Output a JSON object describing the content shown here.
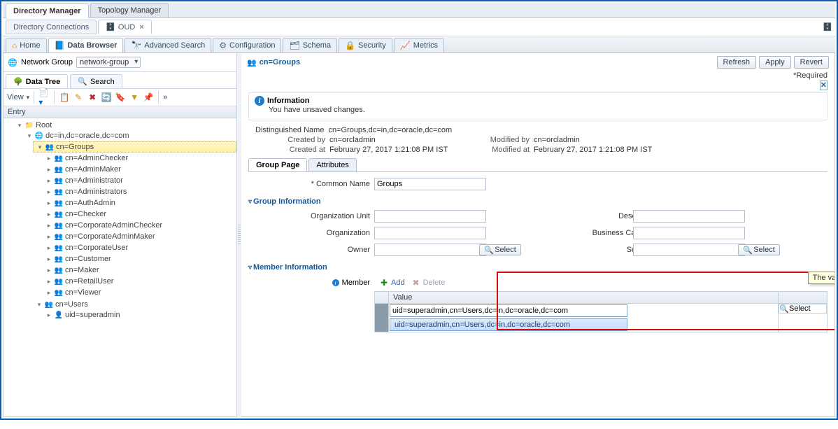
{
  "top_tabs": {
    "directory_manager": "Directory Manager",
    "topology_manager": "Topology Manager"
  },
  "conn_tabs": {
    "directory_connections": "Directory Connections",
    "oud": "OUD"
  },
  "main_tabs": {
    "home": "Home",
    "data_browser": "Data Browser",
    "advanced_search": "Advanced Search",
    "configuration": "Configuration",
    "schema": "Schema",
    "security": "Security",
    "metrics": "Metrics"
  },
  "network_group": {
    "label": "Network Group",
    "value": "network-group"
  },
  "tree_tabs": {
    "data_tree": "Data Tree",
    "search": "Search"
  },
  "toolbar": {
    "view": "View",
    "more": "»"
  },
  "tree": {
    "entry_header": "Entry",
    "root": "Root",
    "dc": "dc=in,dc=oracle,dc=com",
    "groups": "cn=Groups",
    "group_children": [
      "cn=AdminChecker",
      "cn=AdminMaker",
      "cn=Administrator",
      "cn=Administrators",
      "cn=AuthAdmin",
      "cn=Checker",
      "cn=CorporateAdminChecker",
      "cn=CorporateAdminMaker",
      "cn=CorporateUser",
      "cn=Customer",
      "cn=Maker",
      "cn=RetailUser",
      "cn=Viewer"
    ],
    "users": "cn=Users",
    "user_children": [
      "uid=superadmin"
    ]
  },
  "right": {
    "title": "cn=Groups",
    "buttons": {
      "refresh": "Refresh",
      "apply": "Apply",
      "revert": "Revert"
    },
    "required": "*Required",
    "info": {
      "title": "Information",
      "msg": "You have unsaved changes."
    },
    "dn_label": "Distinguished Name",
    "dn_value": "cn=Groups,dc=in,dc=oracle,dc=com",
    "created_by_l": "Created by",
    "created_by_v": "cn=orcladmin",
    "created_at_l": "Created at",
    "created_at_v": "February 27, 2017 1:21:08 PM IST",
    "modified_by_l": "Modified by",
    "modified_by_v": "cn=orcladmin",
    "modified_at_l": "Modified at",
    "modified_at_v": "February 27, 2017 1:21:08 PM IST",
    "sub_tabs": {
      "group_page": "Group Page",
      "attributes": "Attributes"
    },
    "common_name_l": "* Common Name",
    "common_name_v": "Groups",
    "sections": {
      "group_info": "Group Information",
      "member_info": "Member Information"
    },
    "fields": {
      "org_unit": "Organization Unit",
      "description": "Description",
      "organization": "Organization",
      "business_category": "Business Category",
      "owner": "Owner",
      "see_also": "See Also",
      "select": "Select"
    },
    "member_label": "Member",
    "member_toolbar": {
      "add": "Add",
      "delete": "Delete"
    },
    "member_col": "Value",
    "member_value": "uid=superadmin,cn=Users,dc=in,dc=oracle,dc=com",
    "member_suggest": "uid=superadmin,cn=Users,dc=in,dc=oracle,dc=com",
    "tooltip": "The value of attribute."
  }
}
